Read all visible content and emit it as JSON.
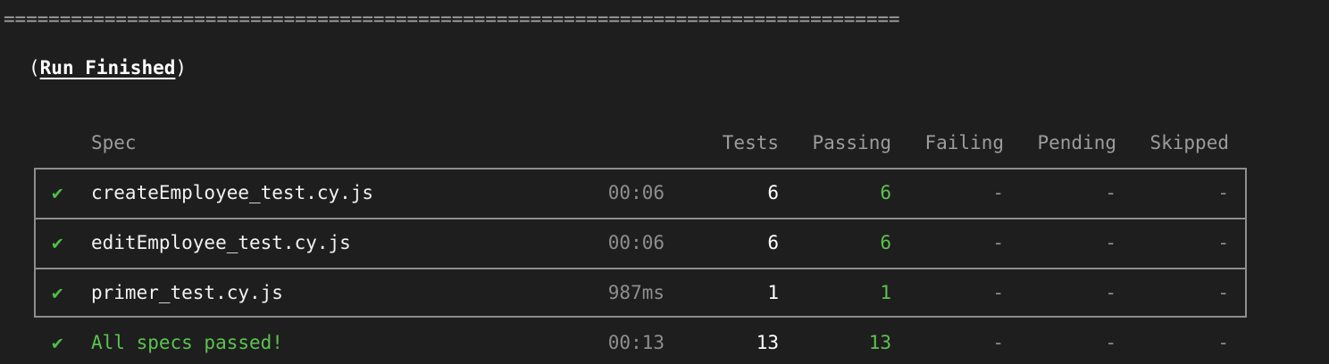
{
  "divider": "================================================================================",
  "run": {
    "open": "(",
    "title": "Run Finished",
    "close": ")"
  },
  "headers": {
    "spec": "Spec",
    "tests": "Tests",
    "passing": "Passing",
    "failing": "Failing",
    "pending": "Pending",
    "skipped": "Skipped"
  },
  "rows": [
    {
      "status": "✔",
      "spec": "createEmployee_test.cy.js",
      "duration": "00:06",
      "tests": "6",
      "passing": "6",
      "failing": "-",
      "pending": "-",
      "skipped": "-"
    },
    {
      "status": "✔",
      "spec": "editEmployee_test.cy.js",
      "duration": "00:06",
      "tests": "6",
      "passing": "6",
      "failing": "-",
      "pending": "-",
      "skipped": "-"
    },
    {
      "status": "✔",
      "spec": "primer_test.cy.js",
      "duration": "987ms",
      "tests": "1",
      "passing": "1",
      "failing": "-",
      "pending": "-",
      "skipped": "-"
    }
  ],
  "summary": {
    "status": "✔",
    "label": "All specs passed!",
    "duration": "00:13",
    "tests": "13",
    "passing": "13",
    "failing": "-",
    "pending": "-",
    "skipped": "-"
  },
  "colors": {
    "background": "#1e1e1e",
    "pass_green": "#5cc24f",
    "muted_gray": "#8e8e8e"
  }
}
